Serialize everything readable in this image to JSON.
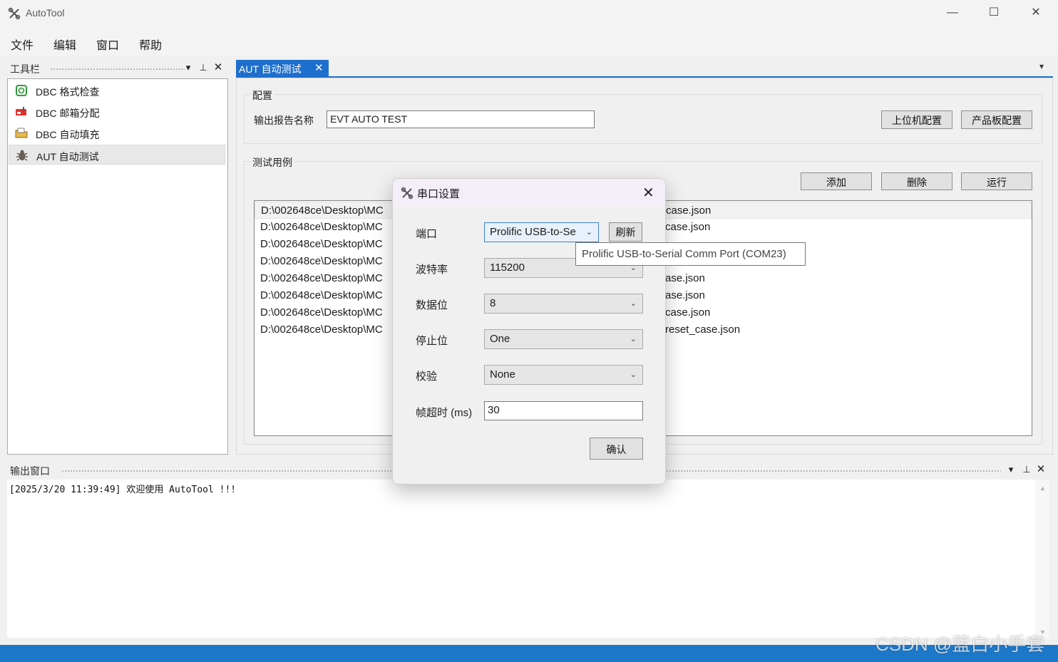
{
  "window": {
    "title": "AutoTool",
    "minimize_glyph": "—",
    "maximize_glyph": "☐",
    "close_glyph": "✕"
  },
  "menu": [
    "文件",
    "编辑",
    "窗口",
    "帮助"
  ],
  "toolbox": {
    "title": "工具栏",
    "items": [
      {
        "label": "DBC 格式检查",
        "icon": "format-check-icon"
      },
      {
        "label": "DBC 邮箱分配",
        "icon": "mailbox-icon"
      },
      {
        "label": "DBC 自动填充",
        "icon": "folder-fill-icon"
      },
      {
        "label": "AUT 自动测试",
        "icon": "bug-icon",
        "selected": true
      }
    ]
  },
  "doc_tab": {
    "label": "AUT 自动测试",
    "close_glyph": "✕"
  },
  "config": {
    "group_title": "配置",
    "report_name_label": "输出报告名称",
    "report_name_value": "EVT AUTO TEST",
    "host_config_button": "上位机配置",
    "board_config_button": "产品板配置"
  },
  "test_cases": {
    "group_title": "测试用例",
    "add_button": "添加",
    "delete_button": "删除",
    "run_button": "运行",
    "rows": [
      {
        "left": "D:\\002648ce\\Desktop\\MC",
        "right": "case.json"
      },
      {
        "left": "D:\\002648ce\\Desktop\\MC",
        "right": "case.json"
      },
      {
        "left": "D:\\002648ce\\Desktop\\MC",
        "right": ""
      },
      {
        "left": "D:\\002648ce\\Desktop\\MC",
        "right": ""
      },
      {
        "left": "D:\\002648ce\\Desktop\\MC",
        "right": "ase.json"
      },
      {
        "left": "D:\\002648ce\\Desktop\\MC",
        "right": "ase.json"
      },
      {
        "left": "D:\\002648ce\\Desktop\\MC",
        "right": "case.json"
      },
      {
        "left": "D:\\002648ce\\Desktop\\MC",
        "right": "reset_case.json"
      }
    ]
  },
  "output": {
    "title": "输出窗口",
    "log_line": "[2025/3/20 11:39:49] 欢迎使用 AutoTool !!!"
  },
  "dialog": {
    "title": "串口设置",
    "close_glyph": "✕",
    "port_label": "端口",
    "port_value": "Prolific USB-to-Se",
    "refresh_button": "刷新",
    "baud_label": "波特率",
    "baud_value": "115200",
    "databits_label": "数据位",
    "databits_value": "8",
    "stopbits_label": "停止位",
    "stopbits_value": "One",
    "parity_label": "校验",
    "parity_value": "None",
    "timeout_label": "帧超时 (ms)",
    "timeout_value": "30",
    "confirm_button": "确认"
  },
  "tooltip": {
    "text": "Prolific USB-to-Serial Comm Port (COM23)"
  },
  "watermark": "CSDN @蓝白小手套",
  "colors": {
    "accent": "#1e6fcd",
    "statusbar": "#1e78c9"
  }
}
